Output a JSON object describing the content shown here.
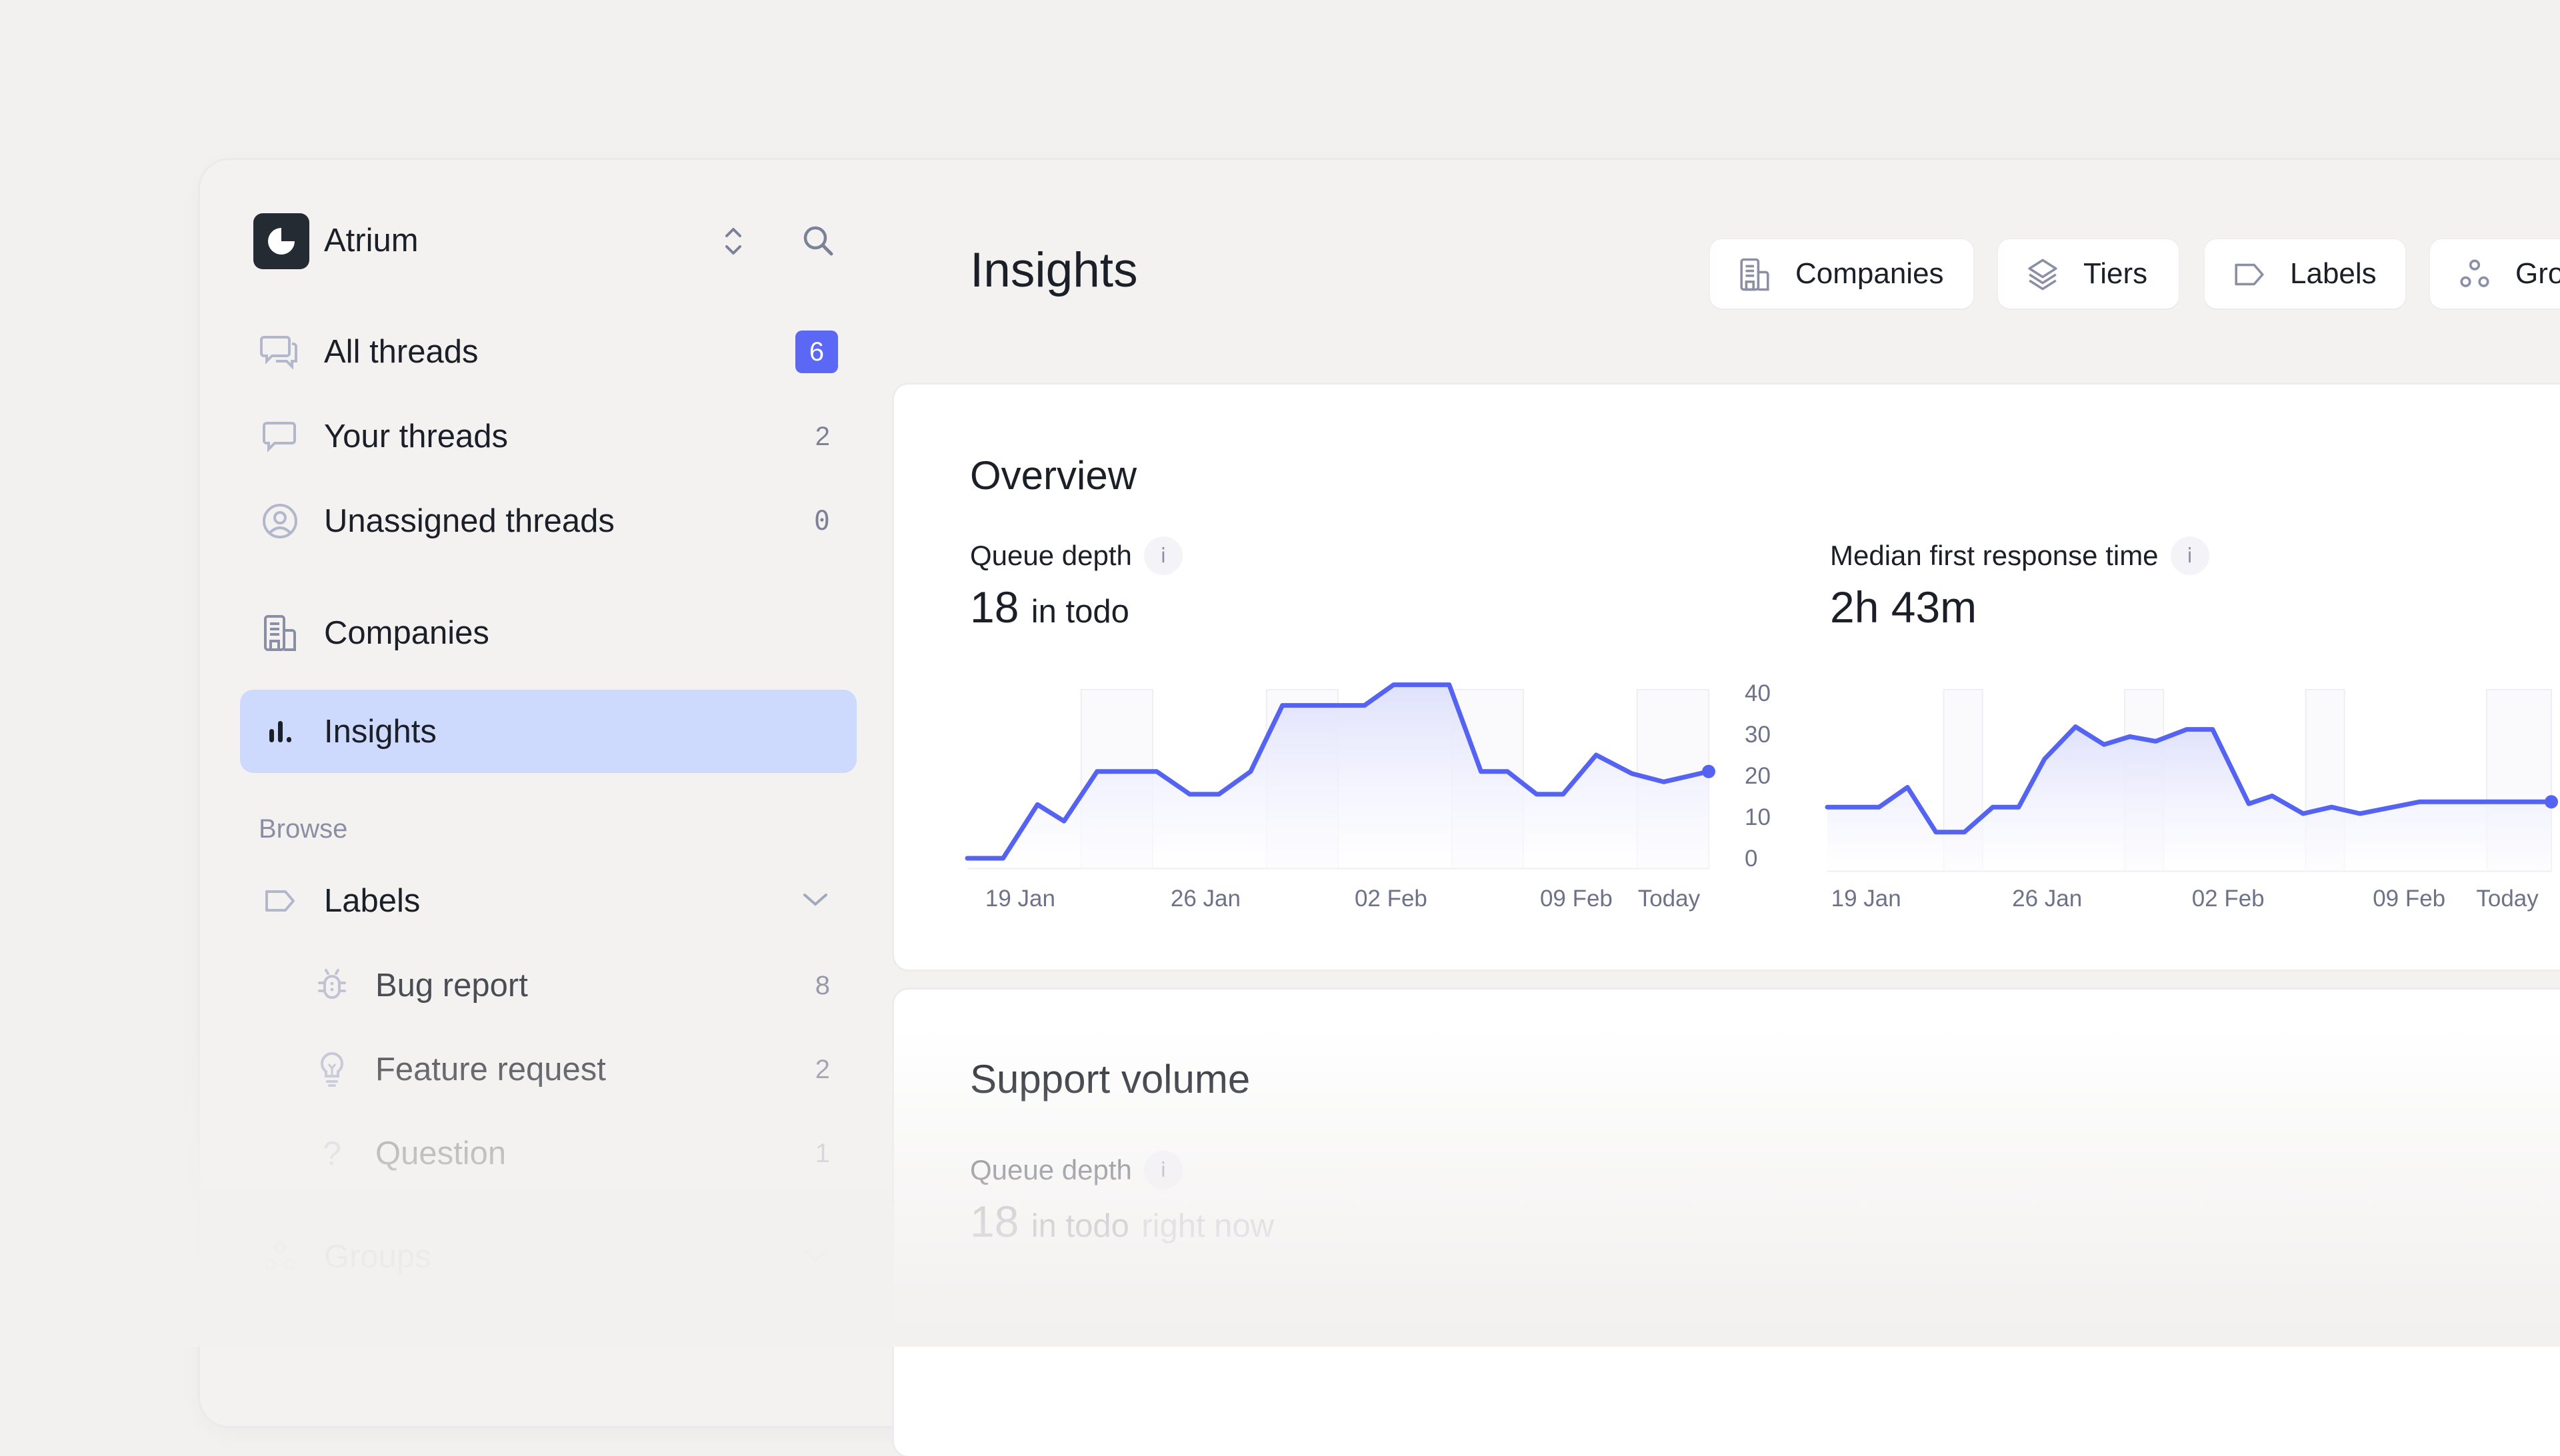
{
  "app": {
    "name": "Atrium",
    "colors": {
      "accent": "#5b68f5",
      "active_nav_bg": "#cdd9fd",
      "chart_line": "#5563f2",
      "logo_bg": "#252b33"
    }
  },
  "sidebar": {
    "switcher_icon": "chevron-up-down-icon",
    "search_icon": "search-icon",
    "primary": [
      {
        "label": "All threads",
        "count": "6",
        "icon": "chat-bubbles-icon",
        "highlight_count": true
      },
      {
        "label": "Your threads",
        "count": "2",
        "icon": "chat-bubble-icon"
      },
      {
        "label": "Unassigned threads",
        "count": "0",
        "icon": "user-circle-icon"
      }
    ],
    "secondary": [
      {
        "label": "Companies",
        "icon": "building-icon"
      },
      {
        "label": "Insights",
        "icon": "bar-chart-icon",
        "active": true
      }
    ],
    "browse_label": "Browse",
    "labels_group": {
      "label": "Labels",
      "icon": "tag-icon",
      "expanded": true,
      "items": [
        {
          "label": "Bug report",
          "count": "8",
          "icon": "bug-icon"
        },
        {
          "label": "Feature request",
          "count": "2",
          "icon": "lightbulb-icon"
        },
        {
          "label": "Question",
          "count": "1",
          "icon": "question-icon"
        }
      ]
    },
    "groups_group": {
      "label": "Groups",
      "icon": "groups-icon"
    }
  },
  "header": {
    "title": "Insights",
    "filters": [
      {
        "label": "Companies",
        "icon": "building-icon"
      },
      {
        "label": "Tiers",
        "icon": "layers-icon"
      },
      {
        "label": "Labels",
        "icon": "tag-icon"
      },
      {
        "label": "Groups",
        "icon": "groups-icon"
      }
    ]
  },
  "overview": {
    "title": "Overview",
    "queue_depth": {
      "label": "Queue depth",
      "value": "18",
      "unit": "in todo"
    },
    "median_first_response": {
      "label": "Median first response time",
      "value": "2h 43m"
    }
  },
  "support_volume": {
    "title": "Support volume",
    "queue_depth": {
      "label": "Queue depth",
      "value": "18",
      "unit": "in todo",
      "suffix": "right now"
    }
  },
  "chart_data": [
    {
      "type": "area",
      "title": "Queue depth",
      "xlabel": "",
      "ylabel": "",
      "ylim": [
        0,
        40
      ],
      "yticks": [
        0,
        10,
        20,
        30,
        40
      ],
      "ytick_labels": [
        "0",
        "10",
        "20",
        "30",
        "40"
      ],
      "y_axis_side": "right",
      "x_range_days": [
        0,
        28
      ],
      "x_tick_labels": [
        {
          "day": 2,
          "label": "19 Jan"
        },
        {
          "day": 9,
          "label": "26 Jan"
        },
        {
          "day": 16,
          "label": "02 Feb"
        },
        {
          "day": 23,
          "label": "09 Feb"
        },
        {
          "day": 26.5,
          "label": "Today"
        }
      ],
      "weekend_bands_days": [
        [
          4.3,
          7.0
        ],
        [
          11.3,
          14.0
        ],
        [
          18.3,
          21.0
        ],
        [
          25.3,
          28.0
        ]
      ],
      "points": [
        [
          0,
          0
        ],
        [
          1.35,
          0
        ],
        [
          2.65,
          13
        ],
        [
          3.65,
          9
        ],
        [
          4.9,
          21
        ],
        [
          7.15,
          21
        ],
        [
          8.4,
          15.5
        ],
        [
          9.5,
          15.5
        ],
        [
          10.7,
          21
        ],
        [
          11.9,
          37
        ],
        [
          15.0,
          37
        ],
        [
          16.1,
          42
        ],
        [
          18.2,
          42
        ],
        [
          19.4,
          21
        ],
        [
          20.4,
          21
        ],
        [
          21.5,
          15.5
        ],
        [
          22.5,
          15.5
        ],
        [
          23.75,
          25
        ],
        [
          25.1,
          20.5
        ],
        [
          26.3,
          18.5
        ],
        [
          28,
          21
        ]
      ],
      "current_value_marker": true,
      "grid": false
    },
    {
      "type": "area",
      "title": "Median first response time",
      "xlabel": "",
      "ylabel": "",
      "ylim": [
        0,
        250
      ],
      "y_axis_visible": false,
      "x_range_days": [
        0,
        28
      ],
      "x_tick_labels": [
        {
          "day": 1.5,
          "label": "19 Jan"
        },
        {
          "day": 8.5,
          "label": "26 Jan"
        },
        {
          "day": 15.5,
          "label": "02 Feb"
        },
        {
          "day": 22.5,
          "label": "09 Feb"
        },
        {
          "day": 26.3,
          "label": "Today"
        }
      ],
      "weekend_bands_days": [
        [
          4.5,
          6.0
        ],
        [
          11.5,
          13.0
        ],
        [
          18.5,
          20.0
        ],
        [
          25.5,
          28.0
        ]
      ],
      "points": [
        [
          0,
          97
        ],
        [
          2.0,
          97
        ],
        [
          3.1,
          127
        ],
        [
          4.2,
          59
        ],
        [
          5.3,
          59
        ],
        [
          6.4,
          97
        ],
        [
          7.4,
          97
        ],
        [
          8.4,
          170
        ],
        [
          9.6,
          219
        ],
        [
          10.7,
          192
        ],
        [
          11.7,
          204
        ],
        [
          12.7,
          197
        ],
        [
          13.9,
          215
        ],
        [
          14.9,
          215
        ],
        [
          16.3,
          102
        ],
        [
          17.2,
          114
        ],
        [
          18.4,
          87
        ],
        [
          19.5,
          97
        ],
        [
          20.6,
          87
        ],
        [
          22.9,
          105
        ],
        [
          28,
          105
        ]
      ],
      "current_value_marker": true,
      "grid": false
    }
  ]
}
